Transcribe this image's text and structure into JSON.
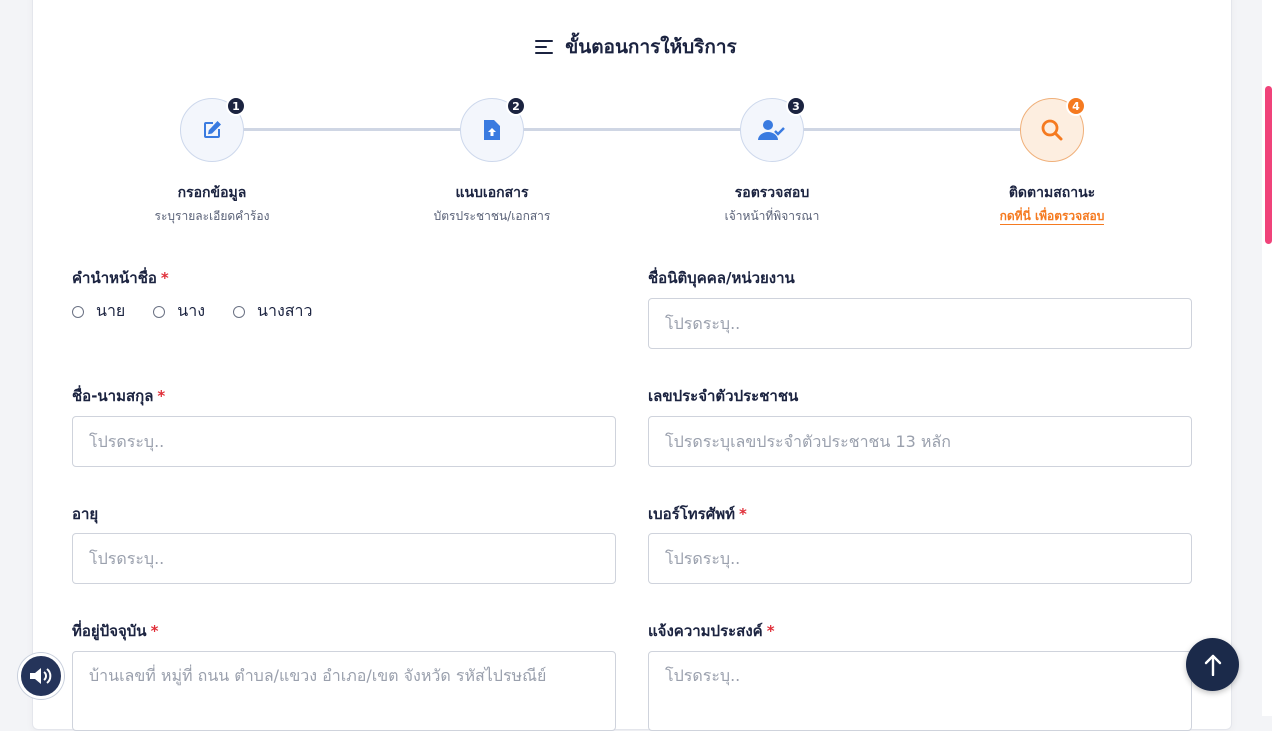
{
  "colors": {
    "accent": "#f57a20",
    "primary_dark": "#1b2340",
    "required": "#e0303a",
    "scroll_thumb": "#f0437a"
  },
  "header": {
    "title": "ขั้นตอนการให้บริการ",
    "icon": "menu-lines-icon"
  },
  "steps": [
    {
      "number": "1",
      "title": "กรอกข้อมูล",
      "subtitle": "ระบุรายละเอียดคำร้อง",
      "icon": "edit-icon"
    },
    {
      "number": "2",
      "title": "แนบเอกสาร",
      "subtitle": "บัตรประชาชน/เอกสาร",
      "icon": "file-upload-icon"
    },
    {
      "number": "3",
      "title": "รอตรวจสอบ",
      "subtitle": "เจ้าหน้าที่พิจารณา",
      "icon": "user-check-icon"
    },
    {
      "number": "4",
      "title": "ติดตามสถานะ",
      "subtitle": "กดที่นี่ เพื่อตรวจสอบ",
      "icon": "search-icon"
    }
  ],
  "form": {
    "prefix": {
      "label": "คำนำหน้าชื่อ",
      "required": "*",
      "options": [
        "นาย",
        "นาง",
        "นางสาว"
      ]
    },
    "org_name": {
      "label": "ชื่อนิติบุคคล/หน่วยงาน",
      "placeholder": "โปรดระบุ..",
      "value": ""
    },
    "full_name": {
      "label": "ชื่อ-นามสกุล",
      "required": "*",
      "placeholder": "โปรดระบุ..",
      "value": ""
    },
    "citizen_id": {
      "label": "เลขประจำตัวประชาชน",
      "placeholder": "โปรดระบุเลขประจำตัวประชาชน 13 หลัก",
      "value": ""
    },
    "age": {
      "label": "อายุ",
      "placeholder": "โปรดระบุ..",
      "value": ""
    },
    "phone": {
      "label": "เบอร์โทรศัพท์",
      "required": "*",
      "placeholder": "โปรดระบุ..",
      "value": ""
    },
    "address": {
      "label": "ที่อยู่ปัจจุบัน",
      "required": "*",
      "placeholder": "บ้านเลขที่ หมู่ที่ ถนน ตำบล/แขวง อำเภอ/เขต จังหวัด รหัสไปรษณีย์",
      "value": ""
    },
    "purpose": {
      "label": "แจ้งความประสงค์",
      "required": "*",
      "placeholder": "โปรดระบุ..",
      "value": ""
    }
  },
  "floating": {
    "scroll_top_icon": "arrow-up-icon",
    "sound_icon": "speaker-icon"
  }
}
